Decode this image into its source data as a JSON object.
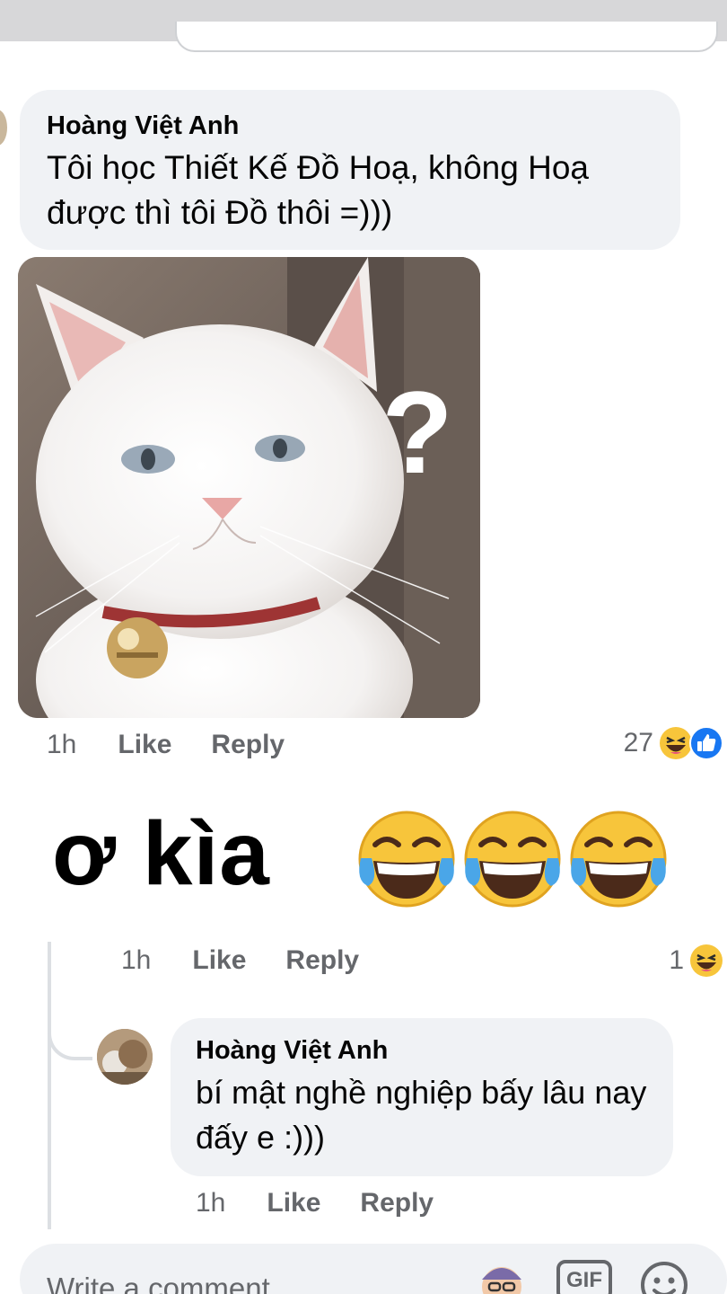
{
  "top_bar": {},
  "comment": {
    "author": "Hoàng Việt Anh",
    "text": "Tôi học Thiết Kế Đồ Hoạ, không Hoạ được thì tôi Đồ thôi =)))",
    "time": "1h",
    "like_label": "Like",
    "reply_label": "Reply",
    "reaction_count": "27",
    "reactions": [
      "haha-icon",
      "like-icon"
    ]
  },
  "sticker_reply": {
    "text": "ơ kìa",
    "emojis": [
      "tears-of-joy-icon",
      "tears-of-joy-icon",
      "tears-of-joy-icon"
    ],
    "time": "1h",
    "like_label": "Like",
    "reply_label": "Reply",
    "reaction_count": "1",
    "reactions": [
      "haha-icon"
    ]
  },
  "nested_reply": {
    "author": "Hoàng Việt Anh",
    "text": "bí mật nghề nghiệp bấy lâu nay đấy e :)))",
    "time": "1h",
    "like_label": "Like",
    "reply_label": "Reply"
  },
  "composer": {
    "placeholder": "Write a comment...",
    "gif_label": "GIF"
  },
  "colors": {
    "bubble": "#f0f2f5",
    "meta_text": "#65676b",
    "like_blue": "#1877f2",
    "emoji_yellow": "#f7c53b"
  }
}
